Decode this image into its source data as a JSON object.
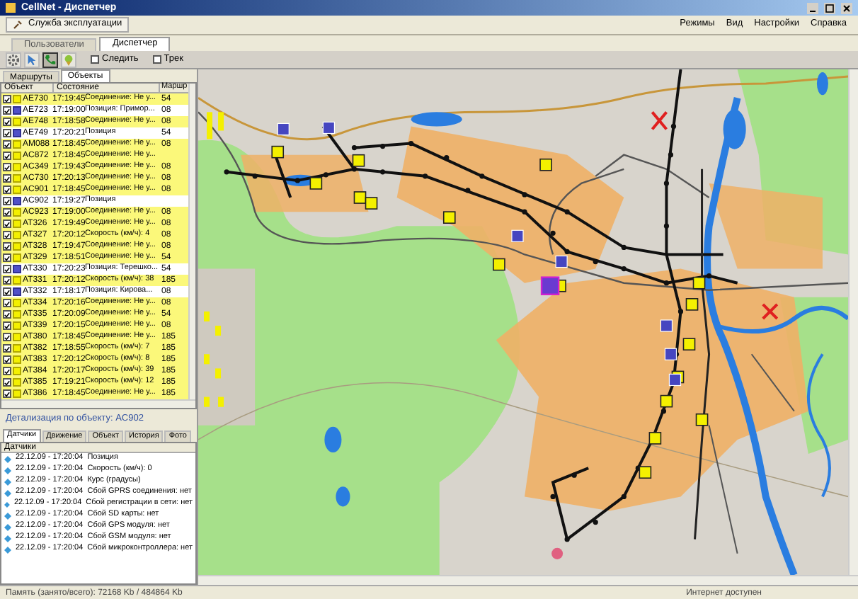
{
  "window": {
    "title": "CellNet - Диспетчер"
  },
  "toolbar": {
    "service_button": "Служба эксплуатации"
  },
  "menu": [
    "Режимы",
    "Вид",
    "Настройки",
    "Справка"
  ],
  "tabs": [
    {
      "label": "Пользователи",
      "selected": false
    },
    {
      "label": "Диспетчер",
      "selected": true
    }
  ],
  "tool_buttons": [
    {
      "kind": "settings",
      "pressed": false
    },
    {
      "kind": "pointer",
      "pressed": false
    },
    {
      "kind": "phone",
      "pressed": true
    },
    {
      "kind": "object",
      "pressed": false
    }
  ],
  "options": [
    {
      "label": "Следить",
      "checked": false
    },
    {
      "label": "Трек",
      "checked": false
    }
  ],
  "left_tabs": [
    {
      "label": "Маршруты",
      "selected": false
    },
    {
      "label": "Объекты",
      "selected": true
    }
  ],
  "table": {
    "columns": [
      "Объект",
      "Состояние",
      "Маршр"
    ],
    "rows": [
      {
        "object": "AE730",
        "time": "17:19:45",
        "state": "Соединение: Не у...",
        "route": "54",
        "checked": true,
        "kind": "moving"
      },
      {
        "object": "AE723",
        "time": "17:19:00",
        "state": "Позиция: Примор...",
        "route": "08",
        "checked": true,
        "kind": "parked"
      },
      {
        "object": "AE748",
        "time": "17:18:58",
        "state": "Соединение: Не у...",
        "route": "08",
        "checked": true,
        "kind": "moving"
      },
      {
        "object": "AE749",
        "time": "17:20:21",
        "state": "Позиция",
        "route": "54",
        "checked": true,
        "kind": "parked"
      },
      {
        "object": "AM088",
        "time": "17:18:45",
        "state": "Соединение: Не у...",
        "route": "08",
        "checked": true,
        "kind": "moving"
      },
      {
        "object": "AC872",
        "time": "17:18:45",
        "state": "Соединение: Не у...",
        "route": "",
        "checked": true,
        "kind": "moving"
      },
      {
        "object": "AC349",
        "time": "17:19:43",
        "state": "Соединение: Не у...",
        "route": "08",
        "checked": true,
        "kind": "moving"
      },
      {
        "object": "AC730",
        "time": "17:20:13",
        "state": "Соединение: Не у...",
        "route": "08",
        "checked": true,
        "kind": "moving"
      },
      {
        "object": "AC901",
        "time": "17:18:45",
        "state": "Соединение: Не у...",
        "route": "08",
        "checked": true,
        "kind": "moving"
      },
      {
        "object": "AC902",
        "time": "17:19:27",
        "state": "Позиция",
        "route": "",
        "checked": true,
        "kind": "parked"
      },
      {
        "object": "AC923",
        "time": "17:19:00",
        "state": "Соединение: Не у...",
        "route": "08",
        "checked": true,
        "kind": "moving"
      },
      {
        "object": "AT326",
        "time": "17:19:49",
        "state": "Соединение: Не у...",
        "route": "08",
        "checked": true,
        "kind": "moving"
      },
      {
        "object": "AT327",
        "time": "17:20:12",
        "state": "Скорость (км/ч): 4",
        "route": "08",
        "checked": true,
        "kind": "moving"
      },
      {
        "object": "AT328",
        "time": "17:19:47",
        "state": "Соединение: Не у...",
        "route": "08",
        "checked": true,
        "kind": "moving"
      },
      {
        "object": "AT329",
        "time": "17:18:51",
        "state": "Соединение: Не у...",
        "route": "54",
        "checked": true,
        "kind": "moving"
      },
      {
        "object": "AT330",
        "time": "17:20:23",
        "state": "Позиция: Терешко...",
        "route": "54",
        "checked": true,
        "kind": "parked"
      },
      {
        "object": "AT331",
        "time": "17:20:12",
        "state": "Скорость (км/ч): 38",
        "route": "185",
        "checked": true,
        "kind": "moving"
      },
      {
        "object": "AT332",
        "time": "17:18:17",
        "state": "Позиция: Кирова...",
        "route": "08",
        "checked": true,
        "kind": "parked"
      },
      {
        "object": "AT334",
        "time": "17:20:16",
        "state": "Соединение: Не у...",
        "route": "08",
        "checked": true,
        "kind": "moving"
      },
      {
        "object": "AT335",
        "time": "17:20:09",
        "state": "Соединение: Не у...",
        "route": "54",
        "checked": true,
        "kind": "moving"
      },
      {
        "object": "AT339",
        "time": "17:20:15",
        "state": "Соединение: Не у...",
        "route": "08",
        "checked": true,
        "kind": "moving"
      },
      {
        "object": "AT380",
        "time": "17:18:45",
        "state": "Соединение: Не у...",
        "route": "185",
        "checked": true,
        "kind": "moving"
      },
      {
        "object": "AT382",
        "time": "17:18:55",
        "state": "Скорость (км/ч): 7",
        "route": "185",
        "checked": true,
        "kind": "moving"
      },
      {
        "object": "AT383",
        "time": "17:20:12",
        "state": "Скорость (км/ч): 8",
        "route": "185",
        "checked": true,
        "kind": "moving"
      },
      {
        "object": "AT384",
        "time": "17:20:17",
        "state": "Скорость (км/ч): 39",
        "route": "185",
        "checked": true,
        "kind": "moving"
      },
      {
        "object": "AT385",
        "time": "17:19:21",
        "state": "Скорость (км/ч): 12",
        "route": "185",
        "checked": true,
        "kind": "moving"
      },
      {
        "object": "AT386",
        "time": "17:18:45",
        "state": "Соединение: Не у...",
        "route": "185",
        "checked": true,
        "kind": "moving"
      }
    ]
  },
  "detail": {
    "title": "Детализация по объекту: AC902",
    "tabs": [
      {
        "label": "Датчики",
        "selected": true
      },
      {
        "label": "Движение",
        "selected": false
      },
      {
        "label": "Объект",
        "selected": false
      },
      {
        "label": "История",
        "selected": false
      },
      {
        "label": "Фото",
        "selected": false
      }
    ],
    "header": "Датчики",
    "items": [
      {
        "time": "22.12.09 - 17:20:04",
        "text": "Позиция"
      },
      {
        "time": "22.12.09 - 17:20:04",
        "text": "Скорость (км/ч): 0"
      },
      {
        "time": "22.12.09 - 17:20:04",
        "text": "Курс (градусы)"
      },
      {
        "time": "22.12.09 - 17:20:04",
        "text": "Сбой GPRS соединения: нет"
      },
      {
        "time": "22.12.09 - 17:20:04",
        "text": "Сбой регистрации в сети: нет"
      },
      {
        "time": "22.12.09 - 17:20:04",
        "text": "Сбой SD карты: нет"
      },
      {
        "time": "22.12.09 - 17:20:04",
        "text": "Сбой GPS модуля: нет"
      },
      {
        "time": "22.12.09 - 17:20:04",
        "text": "Сбой GSM модуля: нет"
      },
      {
        "time": "22.12.09 - 17:20:04",
        "text": "Сбой микроконтроллера: нет"
      }
    ]
  },
  "status_bar": {
    "memory": "Память (занято/всего): 72168 Kb / 484864 Kb",
    "internet": "Интернет доступен"
  }
}
